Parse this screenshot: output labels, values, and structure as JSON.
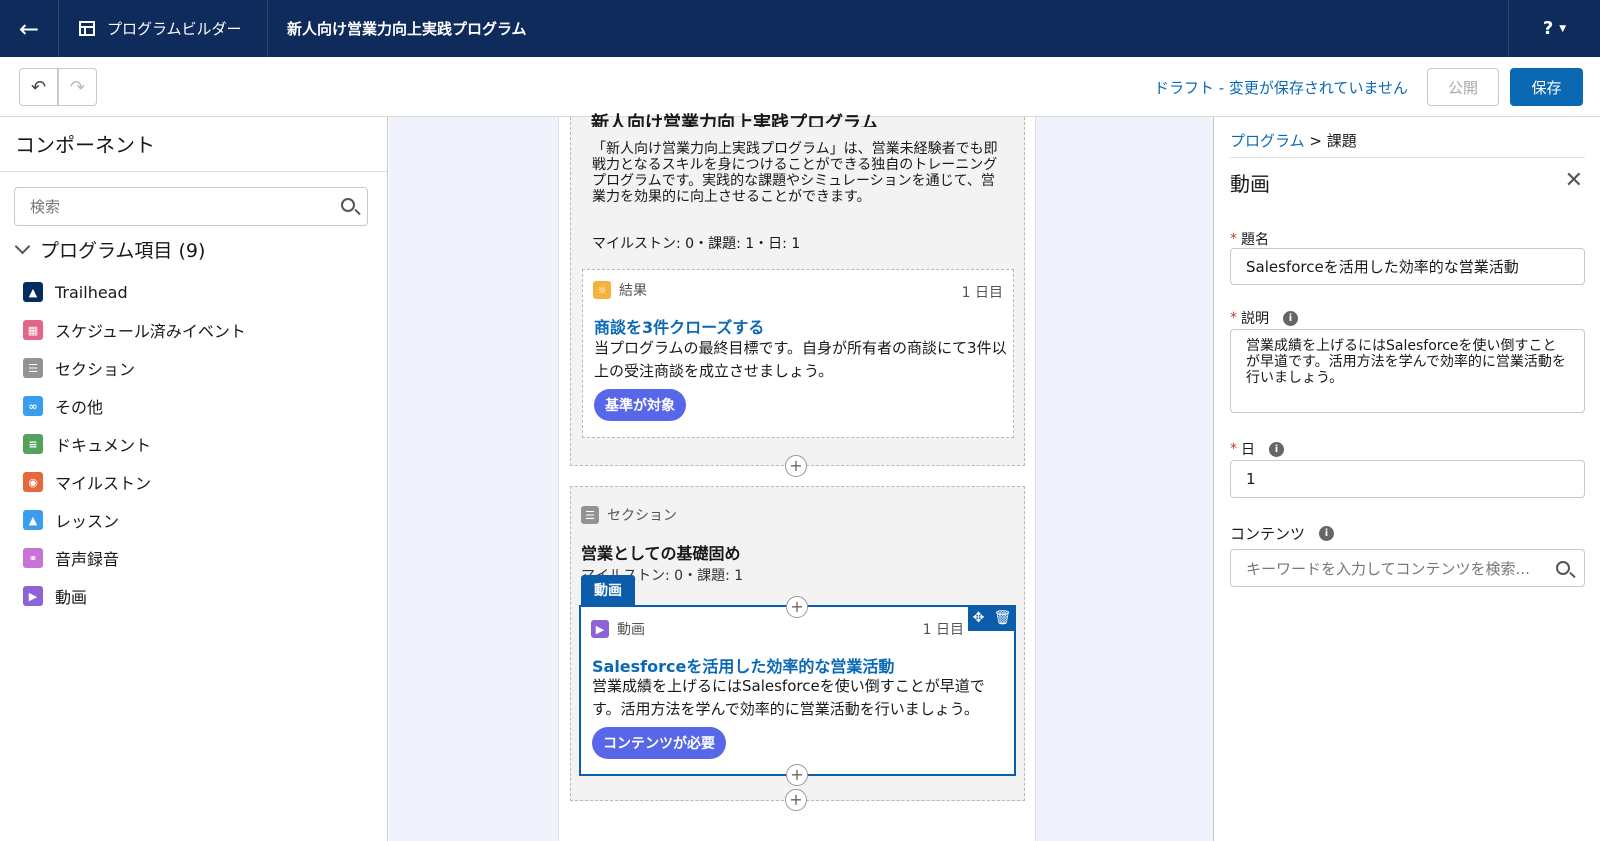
{
  "header": {
    "back_icon": "arrow-left-icon",
    "builder_label": "プログラムビルダー",
    "program_title": "新人向け営業力向上実践プログラム",
    "help_label": "?"
  },
  "toolbar": {
    "undo_icon": "undo-icon",
    "redo_icon": "redo-icon",
    "status": "ドラフト - 変更が保存されていません",
    "publish_label": "公開",
    "save_label": "保存"
  },
  "components": {
    "title": "コンポーネント",
    "search_placeholder": "検索",
    "group_label": "プログラム項目 (9)",
    "items": [
      {
        "label": "Trailhead",
        "color": "#032d60",
        "icon": "trailhead-icon"
      },
      {
        "label": "スケジュール済みイベント",
        "color": "#e3668a",
        "icon": "calendar-icon"
      },
      {
        "label": "セクション",
        "color": "#939393",
        "icon": "section-icon"
      },
      {
        "label": "その他",
        "color": "#3b9dee",
        "icon": "link-icon"
      },
      {
        "label": "ドキュメント",
        "color": "#55a25f",
        "icon": "document-icon"
      },
      {
        "label": "マイルストン",
        "color": "#e5673b",
        "icon": "milestone-icon"
      },
      {
        "label": "レッスン",
        "color": "#3b9dee",
        "icon": "lesson-icon"
      },
      {
        "label": "音声録音",
        "color": "#c774d8",
        "icon": "headphones-icon"
      },
      {
        "label": "動画",
        "color": "#8e62d8",
        "icon": "video-icon"
      }
    ]
  },
  "canvas": {
    "section1": {
      "title": "新人向け営業力向上実践プログラム",
      "description": "「新人向け営業力向上実践プログラム」は、営業未経験者でも即戦力となるスキルを身につけることができる独自のトレーニングプログラムです。実践的な課題やシミュレーションを通じて、営業力を効果的に向上させることができます。",
      "stats": "マイルストン: 0・課題: 1・日: 1",
      "card": {
        "type": "結果",
        "day": "1 日目",
        "title": "商談を3件クローズする",
        "description": "当プログラムの最終目標です。自身が所有者の商談にて3件以上の受注商談を成立させましょう。",
        "badge": "基準が対象"
      }
    },
    "section2": {
      "type": "セクション",
      "title": "営業としての基礎固め",
      "stats": "マイルストン: 0・課題: 1",
      "tab": "動画",
      "card": {
        "type": "動画",
        "day": "1 日目",
        "title": "Salesforceを活用した効率的な営業活動",
        "description": "営業成績を上げるにはSalesforceを使い倒すことが早道です。活用方法を学んで効率的に営業活動を行いましょう。",
        "badge": "コンテンツが必要"
      }
    },
    "plus_label": "+"
  },
  "panel": {
    "breadcrumb_root": "プログラム",
    "breadcrumb_sep": ">",
    "breadcrumb_current": "課題",
    "title": "動画",
    "name_label": "題名",
    "name_value": "Salesforceを活用した効率的な営業活動",
    "desc_label": "説明",
    "desc_value": "営業成績を上げるにはSalesforceを使い倒すことが早道です。活用方法を学んで効率的に営業活動を行いましょう。",
    "day_label": "日",
    "day_value": "1",
    "content_label": "コンテンツ",
    "content_placeholder": "キーワードを入力してコンテンツを検索..."
  }
}
